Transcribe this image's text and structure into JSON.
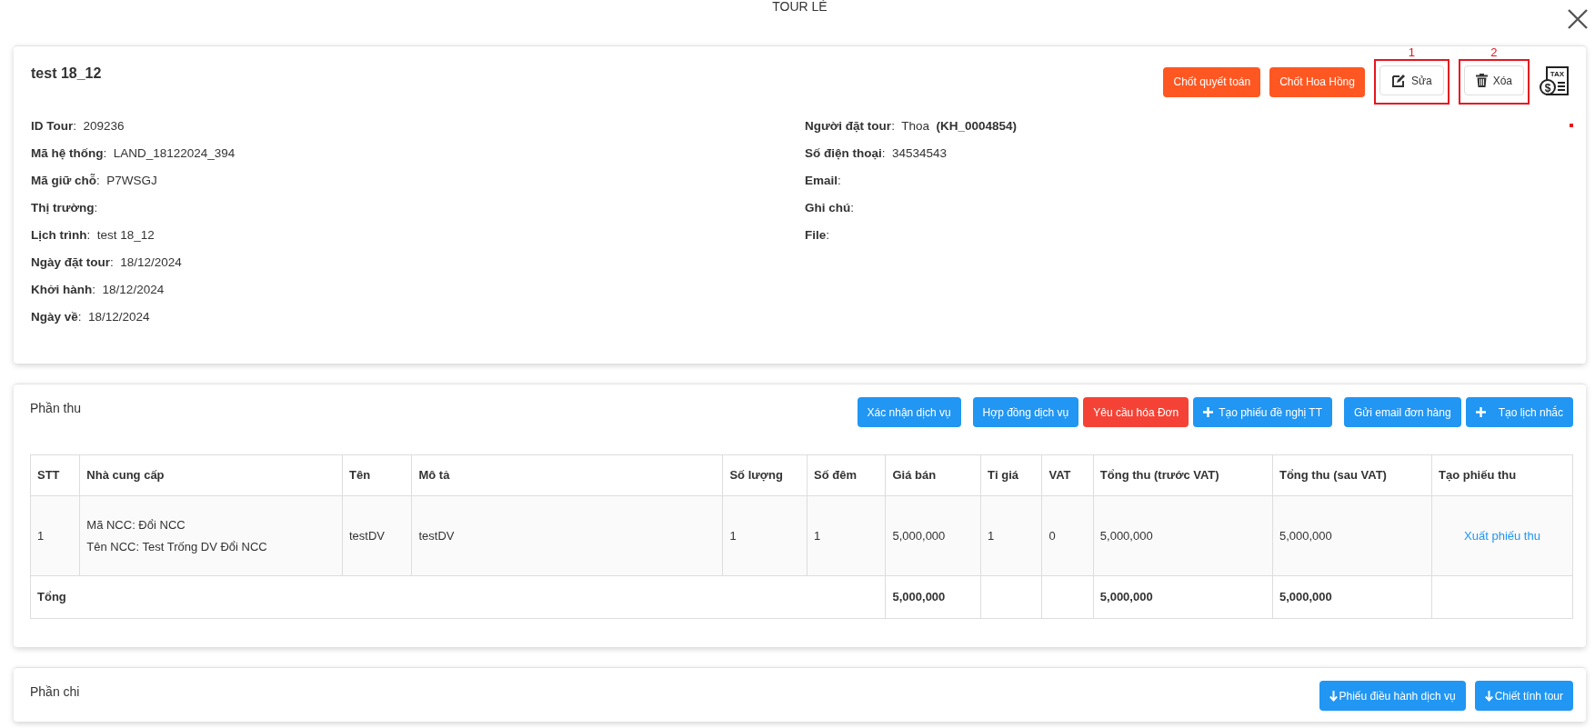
{
  "window": {
    "title": "TOUR LẺ"
  },
  "tour": {
    "name": "test 18_12",
    "actions": [
      {
        "label": "Chốt quyết toán",
        "kind": "accent"
      },
      {
        "label": "Chốt Hoa Hồng",
        "kind": "accent"
      },
      {
        "label": "Sửa",
        "kind": "edit",
        "callout": "1"
      },
      {
        "label": "Xóa",
        "kind": "delete",
        "callout": "2"
      }
    ],
    "tax_icon": {
      "label": "TAX",
      "symbol": "$"
    },
    "left_fields": [
      "**ID Tour**:  209236",
      "**Mã hệ thống**:  LAND_18122024_394",
      "**Mã giữ chỗ**:  P7WSGJ",
      "**Thị trường**:",
      "**Lịch trình**:  test 18_12",
      "**Ngày đặt tour**:  18/12/2024",
      "**Khởi hành**:  18/12/2024",
      "**Ngày về**:  18/12/2024"
    ],
    "right_fields": [
      "**Người đặt tour**:  Thoa  **(KH_0004854)**",
      "**Số điện thoại**:  34534543",
      "**Email**:",
      "**Ghi chú**:",
      "**File**:"
    ]
  },
  "income": {
    "title": "Phần thu",
    "actions": [
      {
        "label": "Xác nhận dịch vụ",
        "kind": "info"
      },
      {
        "label": "Hợp đồng dịch vụ",
        "kind": "info"
      },
      {
        "label": "Yêu cầu hóa Đơn",
        "kind": "alert"
      },
      {
        "label": "Tạo phiếu đề nghị TT",
        "kind": "add"
      },
      {
        "label": "Gửi email đơn hàng",
        "kind": "info"
      },
      {
        "label": "Tạo lịch nhắc",
        "kind": "add-wide"
      }
    ],
    "table": {
      "columns": [
        "STT",
        "Nhà cung cấp",
        "Tên",
        "Mô tả",
        "Số lượng",
        "Số đêm",
        "Giá bán",
        "Tỉ giá",
        "VAT",
        "Tổng thu (trước VAT)",
        "Tổng thu (sau VAT)",
        "Tạo phiếu thu"
      ],
      "rows": [
        {
          "cells": [
            {
              "text": "1"
            },
            {
              "lines": [
                "Mã NCC: Đổi NCC",
                "Tên NCC: Test Trống DV Đổi NCC"
              ]
            },
            {
              "text": "testDV"
            },
            {
              "text": "testDV"
            },
            {
              "text": "1"
            },
            {
              "text": "1"
            },
            {
              "text": "5,000,000"
            },
            {
              "text": "1"
            },
            {
              "text": "0"
            },
            {
              "text": "5,000,000"
            },
            {
              "text": "5,000,000"
            },
            {
              "link": "Xuất phiếu thu"
            }
          ]
        }
      ],
      "total": {
        "label": "Tổng",
        "cells": [
          {
            "text": "5,000,000"
          },
          {
            "blank": true
          },
          {
            "blank": true
          },
          {
            "text": "5,000,000"
          },
          {
            "text": "5,000,000"
          },
          {
            "blank": true
          }
        ]
      }
    }
  },
  "expense": {
    "title": "Phần chi",
    "actions": [
      {
        "label": "Phiếu điều hành dịch vụ",
        "kind": "download"
      },
      {
        "label": "Chiết tính tour",
        "kind": "download"
      }
    ]
  }
}
